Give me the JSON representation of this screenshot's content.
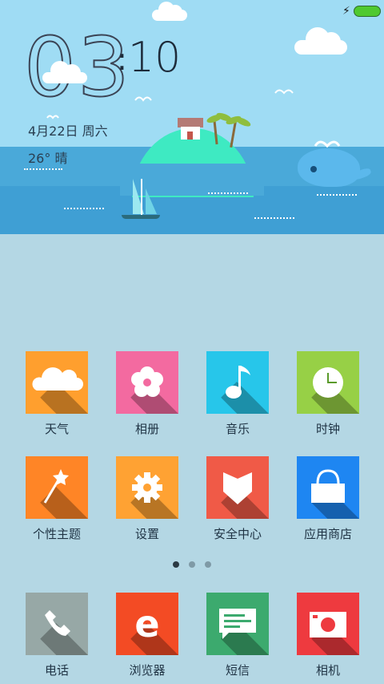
{
  "clock": {
    "hours": "03",
    "minutes": "10",
    "separator": ":"
  },
  "date": "4月22日 周六",
  "weather": "26° 晴",
  "status": {
    "charging_icon": "charging-bolt-icon",
    "battery_level": 1.0
  },
  "apps_row1": [
    {
      "label": "天气",
      "color": "#ff9f2e",
      "icon": "cloud-icon"
    },
    {
      "label": "相册",
      "color": "#f36aa0",
      "icon": "flower-icon"
    },
    {
      "label": "音乐",
      "color": "#27c6ea",
      "icon": "music-note-icon"
    },
    {
      "label": "时钟",
      "color": "#97d046",
      "icon": "clock-icon"
    }
  ],
  "apps_row2": [
    {
      "label": "个性主题",
      "color": "#ff8526",
      "icon": "magic-wand-icon"
    },
    {
      "label": "设置",
      "color": "#ffa233",
      "icon": "gear-icon"
    },
    {
      "label": "安全中心",
      "color": "#f05a47",
      "icon": "shield-icon"
    },
    {
      "label": "应用商店",
      "color": "#1e86f2",
      "icon": "shopping-bag-icon"
    }
  ],
  "page_indicator": {
    "count": 3,
    "active": 0
  },
  "dock": [
    {
      "label": "电话",
      "color": "#97a8a6",
      "icon": "phone-icon"
    },
    {
      "label": "浏览器",
      "color": "#f34b24",
      "icon": "browser-e-icon",
      "glyph": "e"
    },
    {
      "label": "短信",
      "color": "#3caa6e",
      "icon": "message-icon"
    },
    {
      "label": "相机",
      "color": "#ee3a3f",
      "icon": "camera-icon"
    }
  ]
}
